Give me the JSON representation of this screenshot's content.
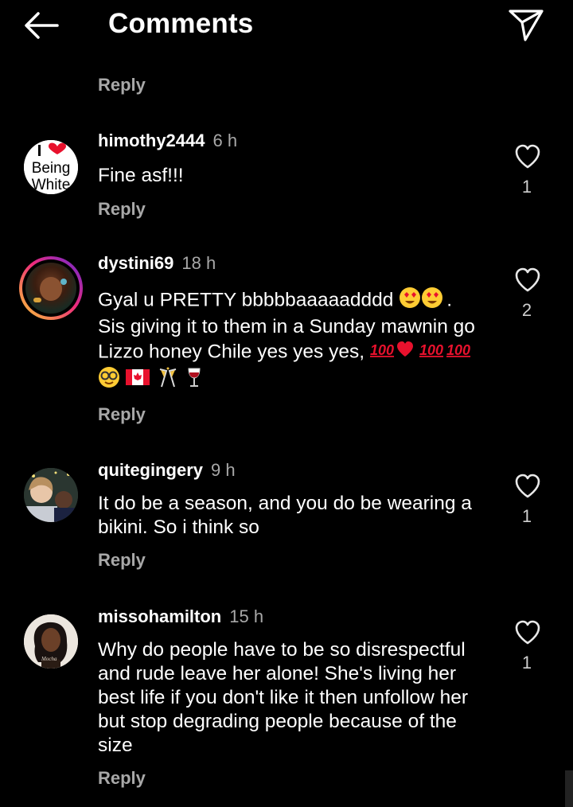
{
  "header": {
    "title": "Comments"
  },
  "top_reply": "Reply",
  "comments": [
    {
      "username": "himothy2444",
      "time": "6 h",
      "text": "Fine asf!!!",
      "likes": "1",
      "reply": "Reply",
      "avatar_text": [
        "Being",
        "White"
      ]
    },
    {
      "username": "dystini69",
      "time": "18 h",
      "text_lines": [
        "Gyal u PRETTY bbbbbaaaaadddd",
        "Sis giving it to them in a Sunday mawnin go",
        "Lizzo honey Chile yes yes yes,"
      ],
      "likes": "2",
      "reply": "Reply"
    },
    {
      "username": "quitegingery",
      "time": "9 h",
      "text_lines": [
        "It do be a season, and you do be wearing a",
        "bikini. So i think so"
      ],
      "likes": "1",
      "reply": "Reply"
    },
    {
      "username": "missohamilton",
      "time": "15 h",
      "text_lines": [
        "Why do people have to be so disrespectful",
        "and rude leave her alone! She's living her",
        "best life if you don't like it then unfollow her",
        "but stop degrading people because of the",
        "size"
      ],
      "likes": "1",
      "reply": "Reply",
      "avatar_text": "Mocha"
    }
  ],
  "icons": {
    "back": "arrow-left-icon",
    "send": "paper-plane-icon",
    "like": "heart-outline-icon"
  },
  "colors": {
    "background": "#000000",
    "secondary_text": "#a8a8a8",
    "story_ring_start": "#f9ce34",
    "story_ring_mid": "#ee2a7b",
    "story_ring_end": "#6228d7"
  }
}
